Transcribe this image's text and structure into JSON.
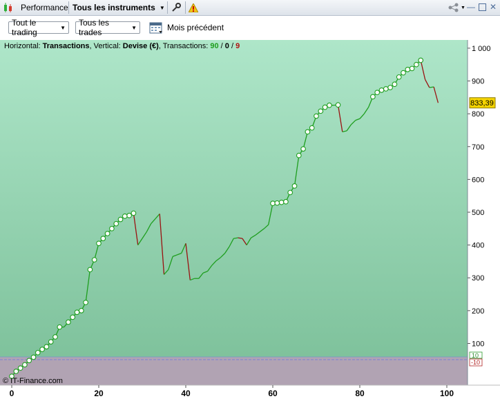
{
  "titlebar": {
    "tab_performance": "Performance",
    "tab_instruments": "Tous les instruments",
    "wrench_icon": "wrench-icon",
    "warning_icon": "warning-icon",
    "share_icon": "share-icon"
  },
  "toolbar": {
    "filter1": "Tout le trading",
    "filter2": "Tous les trades",
    "period_label": "Mois précédent"
  },
  "info": {
    "h_label": "Horizontal: ",
    "h_value": "Transactions",
    "sep1": ", Vertical: ",
    "v_value": "Devise (€)",
    "sep2": ", Transactions: ",
    "count_win": "90",
    "slash1": " / ",
    "count_neutral": "0",
    "slash2": " / ",
    "count_loss": "9"
  },
  "footer": {
    "copyright": "© IT-Finance.com"
  },
  "colors": {
    "win": "#1e9e1e",
    "loss": "#9a1010",
    "area_top": "#aee6c9",
    "area_bottom": "#7fc29c",
    "neg_area": "#b1a3b3"
  },
  "chart_data": {
    "type": "line",
    "xlim": [
      0,
      100
    ],
    "ylim": [
      -25,
      1025
    ],
    "x_ticks": [
      0,
      20,
      40,
      60,
      80,
      100
    ],
    "x_tick_labels": [
      "0",
      "20",
      "40",
      "60",
      "80",
      "100"
    ],
    "y_ticks": [
      100,
      200,
      300,
      400,
      500,
      600,
      700,
      800,
      900,
      1000
    ],
    "y_tick_labels": [
      "100",
      "200",
      "300",
      "400",
      "500",
      "600",
      "700",
      "800",
      "900",
      "1 000"
    ],
    "last_value_label": "833,39",
    "last_value": 833.39,
    "top_band_label": "10",
    "bottom_band_label": "-10",
    "series": [
      {
        "values": [
          0,
          15,
          25,
          35,
          48,
          58,
          72,
          82,
          90,
          105,
          120,
          150,
          150,
          165,
          180,
          195,
          200,
          225,
          325,
          355,
          405,
          420,
          435,
          450,
          465,
          478,
          488,
          490,
          497,
          400,
          420,
          440,
          465,
          480,
          495,
          310,
          325,
          365,
          370,
          375,
          405,
          293,
          298,
          298,
          315,
          320,
          338,
          352,
          362,
          375,
          395,
          420,
          422,
          420,
          400,
          422,
          430,
          440,
          450,
          462,
          527,
          528,
          530,
          532,
          560,
          580,
          673,
          693,
          745,
          757,
          793,
          808,
          820,
          826,
          826,
          827,
          745,
          748,
          767,
          780,
          785,
          800,
          820,
          852,
          865,
          872,
          876,
          880,
          890,
          912,
          925,
          935,
          938,
          950,
          963,
          905,
          880,
          882,
          833.39
        ]
      }
    ]
  }
}
